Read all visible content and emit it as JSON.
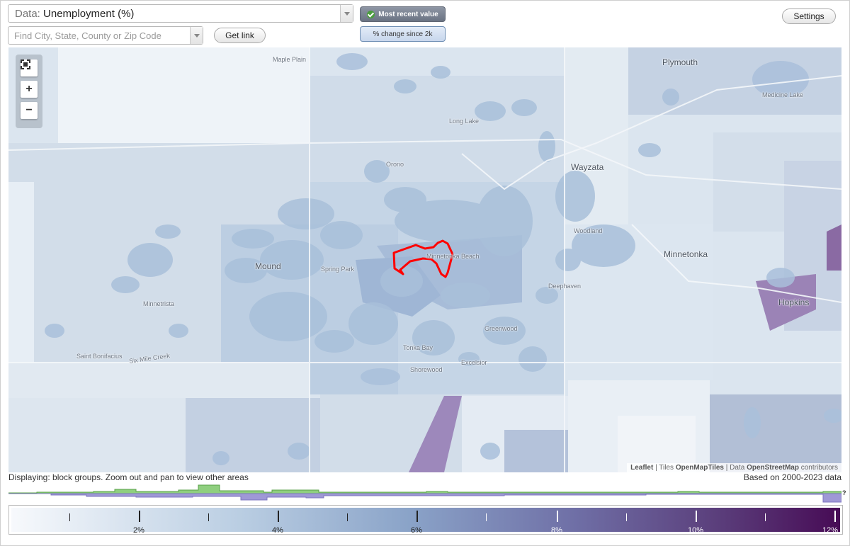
{
  "toolbar": {
    "data_prefix": "Data:",
    "data_value": "Unemployment (%)",
    "search_placeholder": "Find City, State, County or Zip Code",
    "get_link": "Get link",
    "most_recent": "Most recent value",
    "pct_change": "% change since 2k",
    "settings": "Settings"
  },
  "map": {
    "places": [
      {
        "name": "Maple Plain",
        "size": "small"
      },
      {
        "name": "Plymouth",
        "size": "big"
      },
      {
        "name": "Medicine Lake",
        "size": "small"
      },
      {
        "name": "Long Lake",
        "size": "small"
      },
      {
        "name": "Orono",
        "size": "small"
      },
      {
        "name": "Wayzata",
        "size": "big"
      },
      {
        "name": "Woodland",
        "size": "small"
      },
      {
        "name": "Minnetonka",
        "size": "big"
      },
      {
        "name": "Mound",
        "size": "big"
      },
      {
        "name": "Spring Park",
        "size": "small"
      },
      {
        "name": "Minnetonka Beach",
        "size": "small"
      },
      {
        "name": "Deephaven",
        "size": "small"
      },
      {
        "name": "Hopkins",
        "size": "big"
      },
      {
        "name": "Minnetrista",
        "size": "small"
      },
      {
        "name": "Greenwood",
        "size": "small"
      },
      {
        "name": "Saint Bonifacius",
        "size": "small"
      },
      {
        "name": "Six Mile Creek",
        "size": "small"
      },
      {
        "name": "Tonka Bay",
        "size": "small"
      },
      {
        "name": "Excelsior",
        "size": "small"
      },
      {
        "name": "Shorewood",
        "size": "small"
      }
    ],
    "attribution": {
      "leaflet": "Leaflet",
      "sep1": " | Tiles ",
      "tiles": "OpenMapTiles",
      "sep2": " | Data ",
      "data": "OpenStreetMap",
      "tail": " contributors"
    },
    "zoom_in": "+",
    "zoom_out": "−"
  },
  "status": {
    "displaying": "Displaying: block groups. Zoom out and pan to view other areas",
    "based_on": "Based on 2000-2023 data",
    "unknown_marker": "?"
  },
  "legend": {
    "labels": [
      "2%",
      "4%",
      "6%",
      "8%",
      "10%",
      "12%"
    ],
    "max_value": 12
  },
  "colors": {
    "highlight_outline": "#ff0000",
    "histogram_above": "#8fcf7f",
    "histogram_below": "#9f98d6",
    "scale_low": "#f7f9fc",
    "scale_high": "#470b55"
  }
}
